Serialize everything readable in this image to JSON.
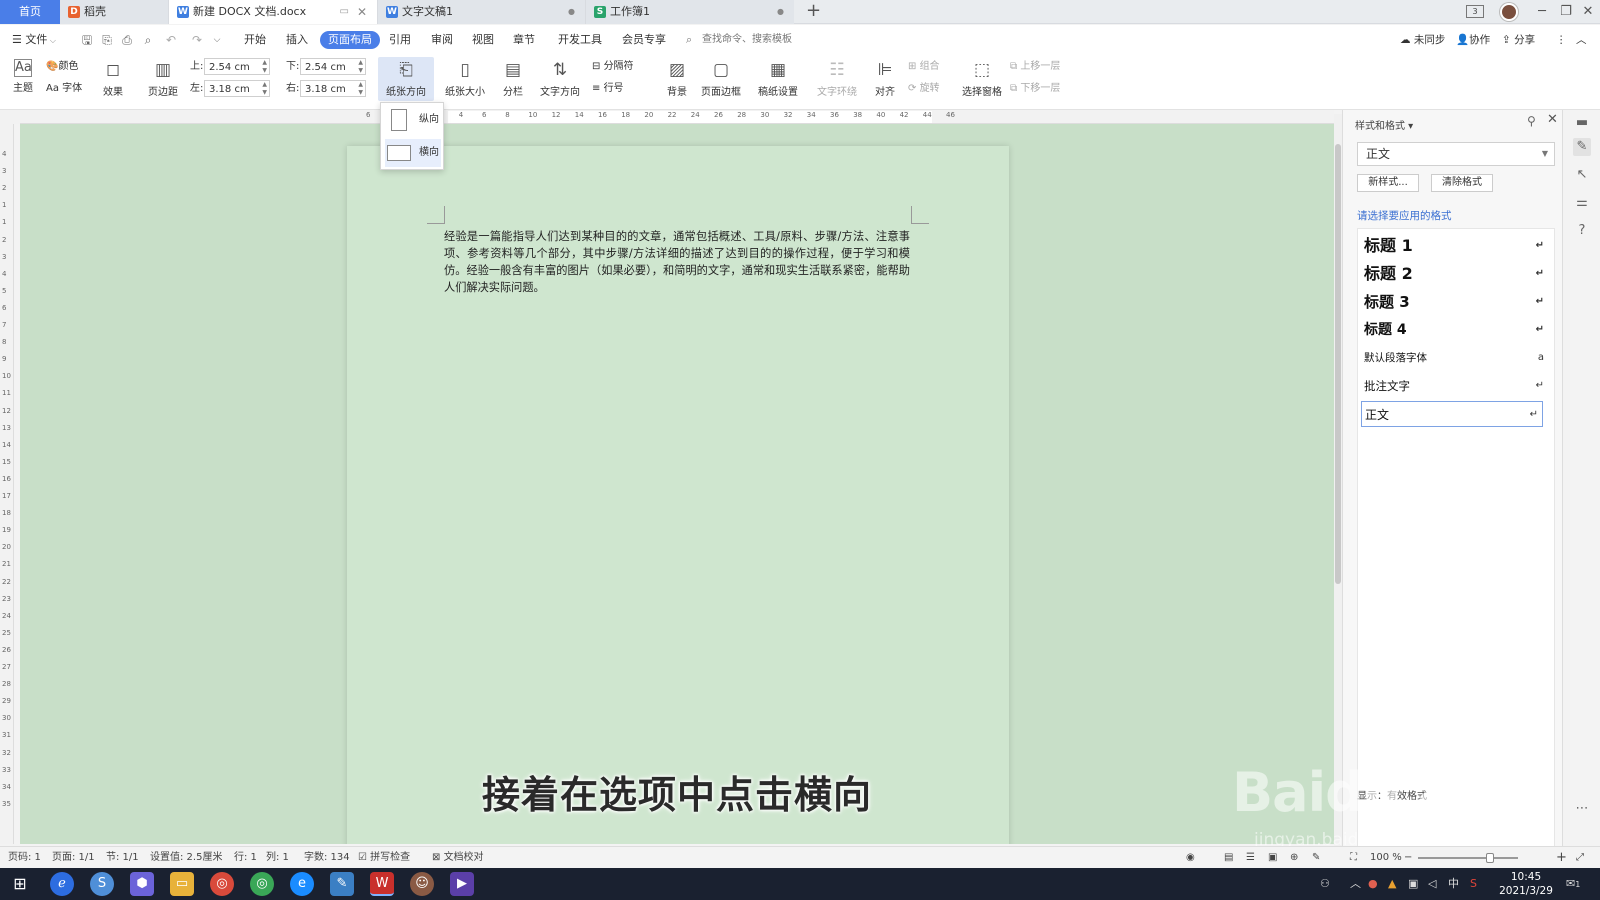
{
  "tabs": {
    "home": "首页",
    "daoke": "稻壳",
    "active_doc": "新建 DOCX 文档.docx",
    "doc2": "文字文稿1",
    "sheet1": "工作簿1",
    "add": "+"
  },
  "titlebar": {
    "window_count": "3"
  },
  "menu": {
    "file": "文件",
    "items": [
      "开始",
      "插入",
      "页面布局",
      "引用",
      "审阅",
      "视图",
      "章节",
      "开发工具",
      "会员专享"
    ],
    "active": "页面布局",
    "search_placeholder": "查找命令、搜索模板",
    "sync": "未同步",
    "collab": "协作",
    "share": "分享"
  },
  "ribbon": {
    "theme": "主题",
    "color": "颜色",
    "font": "字体",
    "effect": "效果",
    "margins": "页边距",
    "margin_top_label": "上:",
    "margin_top": "2.54 cm",
    "margin_bottom_label": "下:",
    "margin_bottom": "2.54 cm",
    "margin_left_label": "左:",
    "margin_left": "3.18 cm",
    "margin_right_label": "右:",
    "margin_right": "3.18 cm",
    "orientation": "纸张方向",
    "paper_size": "纸张大小",
    "columns": "分栏",
    "text_direction": "文字方向",
    "separator": "分隔符",
    "line_numbers": "行号",
    "background": "背景",
    "page_border": "页面边框",
    "grid_setting": "稿纸设置",
    "text_wrap": "文字环绕",
    "align": "对齐",
    "group": "组合",
    "rotate": "旋转",
    "selection_pane": "选择窗格",
    "bring_forward": "上移一层",
    "send_backward": "下移一层"
  },
  "orientation_menu": {
    "portrait": "纵向",
    "landscape": "横向"
  },
  "ruler": {
    "h_ticks": [
      "6",
      "4",
      "2",
      "2",
      "4",
      "6",
      "8",
      "10",
      "12",
      "14",
      "16",
      "18",
      "20",
      "22",
      "24",
      "26",
      "28",
      "30",
      "32",
      "34",
      "36",
      "38",
      "40",
      "42",
      "44",
      "46"
    ],
    "v_ticks": [
      "4",
      "3",
      "2",
      "1",
      "1",
      "2",
      "3",
      "4",
      "5",
      "6",
      "7",
      "8",
      "9",
      "10",
      "11",
      "12",
      "13",
      "14",
      "15",
      "16",
      "17",
      "18",
      "19",
      "20",
      "21",
      "22",
      "23",
      "24",
      "25",
      "26",
      "27",
      "28",
      "29",
      "30",
      "31",
      "32",
      "33",
      "34",
      "35"
    ]
  },
  "document": {
    "paragraph": "经验是一篇能指导人们达到某种目的的文章，通常包括概述、工具/原料、步骤/方法、注意事项、参考资料等几个部分，其中步骤/方法详细的描述了达到目的的操作过程，便于学习和模仿。经验一般含有丰富的图片（如果必要），和简明的文字，通常和现实生活联系紧密，能帮助人们解决实际问题。"
  },
  "subtitle": "接着在选项中点击横向",
  "style_panel": {
    "title": "样式和格式",
    "current": "正文",
    "new_style": "新样式...",
    "clear_format": "清除格式",
    "hint": "请选择要应用的格式",
    "styles": [
      {
        "name": "标题  1",
        "mark": "↵"
      },
      {
        "name": "标题  2",
        "mark": "↵"
      },
      {
        "name": "标题  3",
        "mark": "↵"
      },
      {
        "name": "标题 4",
        "mark": "↵"
      },
      {
        "name": "默认段落字体",
        "mark": "a"
      },
      {
        "name": "批注文字",
        "mark": "↵"
      },
      {
        "name": "正文",
        "mark": "↵"
      }
    ],
    "footer": "显示：有效格式"
  },
  "status": {
    "page_num": "页码: 1",
    "pages": "页面: 1/1",
    "section": "节: 1/1",
    "setting": "设置值: 2.5厘米",
    "row": "行: 1",
    "col": "列: 1",
    "words": "字数: 134",
    "spell": "拼写检查",
    "proof": "文档校对",
    "zoom": "100 %"
  },
  "taskbar": {
    "time": "10:45",
    "date": "2021/3/29",
    "ime": "中",
    "notif": "1"
  },
  "watermark": {
    "brand": "Baidu 经验",
    "url": "jingyan.baidu.com"
  },
  "colors": {
    "accent": "#4a7ee8",
    "canvas": "#c8dfc8",
    "page": "#cfe6cf"
  }
}
